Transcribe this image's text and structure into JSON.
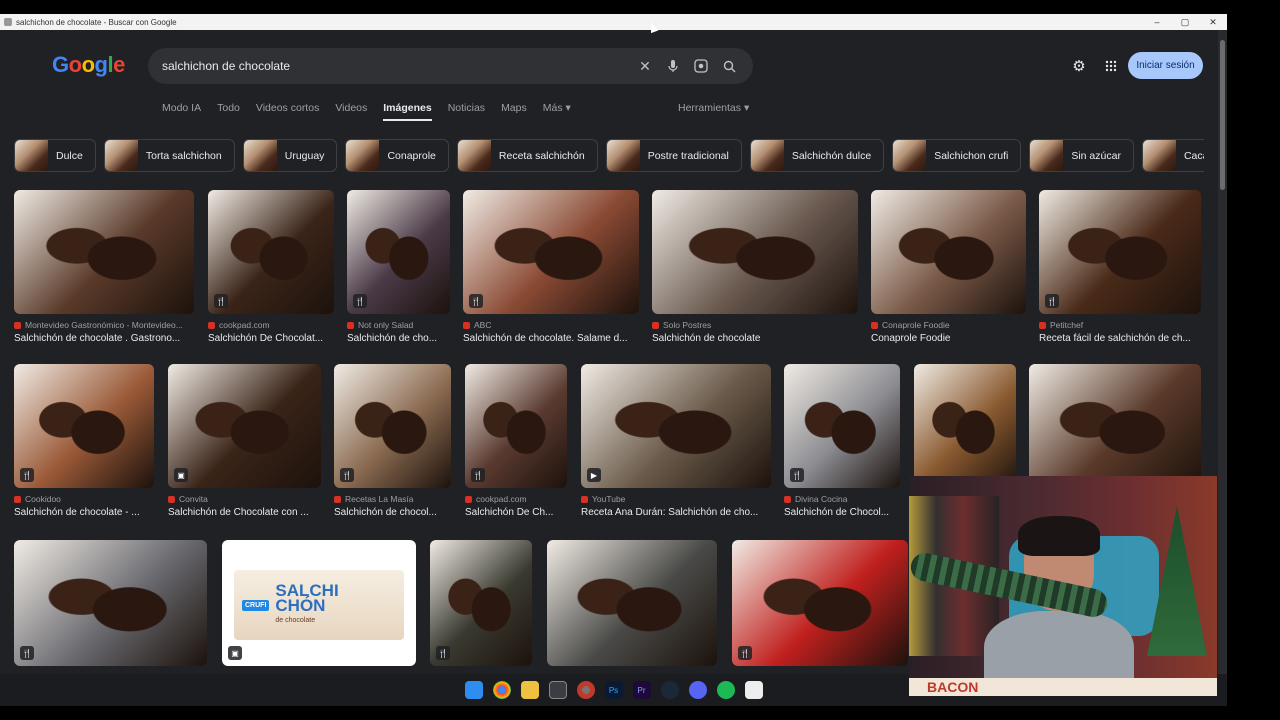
{
  "window": {
    "title": "salchichon de chocolate - Buscar con Google",
    "min": "–",
    "max": "▢",
    "close": "✕"
  },
  "header": {
    "logo": [
      "G",
      "o",
      "o",
      "g",
      "l",
      "e"
    ],
    "search_value": "salchichon de chocolate",
    "signin_label": "Iniciar sesión"
  },
  "tabs": [
    "Modo IA",
    "Todo",
    "Videos cortos",
    "Videos",
    "Imágenes",
    "Noticias",
    "Maps",
    "Más ▾"
  ],
  "active_tab": "Imágenes",
  "tools_label": "Herramientas ▾",
  "chips": [
    "Dulce",
    "Torta salchichon",
    "Uruguay",
    "Conaprole",
    "Receta salchichón",
    "Postre tradicional",
    "Salchichón dulce",
    "Salchichon crufi",
    "Sin azúcar",
    "Cacao amarg"
  ],
  "results": [
    {
      "source": "Montevideo Gastronómico - Montevideo...",
      "caption": "Salchichón de chocolate . Gastrono...",
      "color": "#5a3a2a",
      "badge": ""
    },
    {
      "source": "cookpad.com",
      "caption": "Salchichón De Chocolat...",
      "color": "#3a2418",
      "badge": "🍴"
    },
    {
      "source": "Not only Salad",
      "caption": "Salchichón de cho...",
      "color": "#4a3a48",
      "badge": "🍴"
    },
    {
      "source": "ABC",
      "caption": "Salchichón de chocolate. Salame d...",
      "color": "#8a4a34",
      "badge": "🍴"
    },
    {
      "source": "Solo Postres",
      "caption": "Salchichón de chocolate",
      "color": "#6a5a50",
      "badge": ""
    },
    {
      "source": "Conaprole Foodie",
      "caption": "Conaprole Foodie",
      "color": "#7a5a48",
      "badge": ""
    },
    {
      "source": "Petitchef",
      "caption": "Receta fácil de salchichón de ch...",
      "color": "#4a2a18",
      "badge": "🍴"
    },
    {
      "source": "Cookidoo",
      "caption": "Salchichón de chocolate - ...",
      "color": "#9a5a38",
      "badge": "🍴"
    },
    {
      "source": "Convita",
      "caption": "Salchichón de Chocolate con ...",
      "color": "#3a2418",
      "badge": "▣"
    },
    {
      "source": "Recetas La Masía",
      "caption": "Salchichón de chocol...",
      "color": "#8a6a50",
      "badge": "🍴"
    },
    {
      "source": "cookpad.com",
      "caption": "Salchichón De Ch...",
      "color": "#5a3a30",
      "badge": "🍴"
    },
    {
      "source": "YouTube",
      "caption": "Receta Ana Durán: Salchichón de cho...",
      "color": "#6a5a4a",
      "badge": "▶"
    },
    {
      "source": "Divina Cocina",
      "caption": "Salchichón de Chocol...",
      "color": "#8a8a90",
      "badge": "🍴"
    },
    {
      "source": "",
      "caption": "",
      "color": "#8a5a30",
      "badge": ""
    },
    {
      "source": "",
      "caption": "",
      "color": "#5a3a2a",
      "badge": ""
    },
    {
      "source": "",
      "caption": "",
      "color": "#6a6a70",
      "badge": "🍴"
    },
    {
      "source": "",
      "caption": "",
      "color": "#d8c8b0",
      "badge": "▣"
    },
    {
      "source": "",
      "caption": "",
      "color": "#3a3a30",
      "badge": "🍴"
    },
    {
      "source": "",
      "caption": "",
      "color": "#4a4a48",
      "badge": ""
    },
    {
      "source": "",
      "caption": "",
      "color": "#c0201e",
      "badge": "🍴"
    }
  ],
  "product_box": {
    "brand": "CRUFI",
    "name_line1": "SALCHI",
    "name_line2": "CHÓN",
    "sub": "de chocolate"
  },
  "webcam_banner": "BACON",
  "taskbar": [
    "windows-icon",
    "chrome-icon",
    "files-icon",
    "app-icon",
    "chrome-icon",
    "photoshop-icon",
    "premiere-icon",
    "steam-icon",
    "discord-icon",
    "spotify-icon",
    "app-icon"
  ],
  "taskbar_labels": {
    "ps": "Ps",
    "pr": "Pr"
  }
}
